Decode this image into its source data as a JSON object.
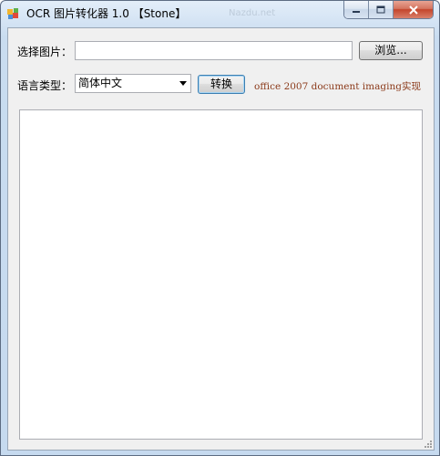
{
  "window": {
    "title": "OCR 图片转化器 1.0 【Stone】",
    "title_ghost": "Nazdu.net"
  },
  "form": {
    "image_label": "选择图片：",
    "image_path_value": "",
    "browse_label": "浏览...",
    "language_label": "语言类型：",
    "language_selected": "简体中文",
    "convert_label": "转换",
    "note": "office 2007 document imaging实现",
    "output_text": ""
  },
  "colors": {
    "note": "#8b3a1a",
    "client_bg": "#f0f0f0"
  },
  "icons": [
    "app-icon",
    "minimize-icon",
    "maximize-icon",
    "close-icon",
    "chevron-down-icon",
    "resize-grip-icon"
  ]
}
